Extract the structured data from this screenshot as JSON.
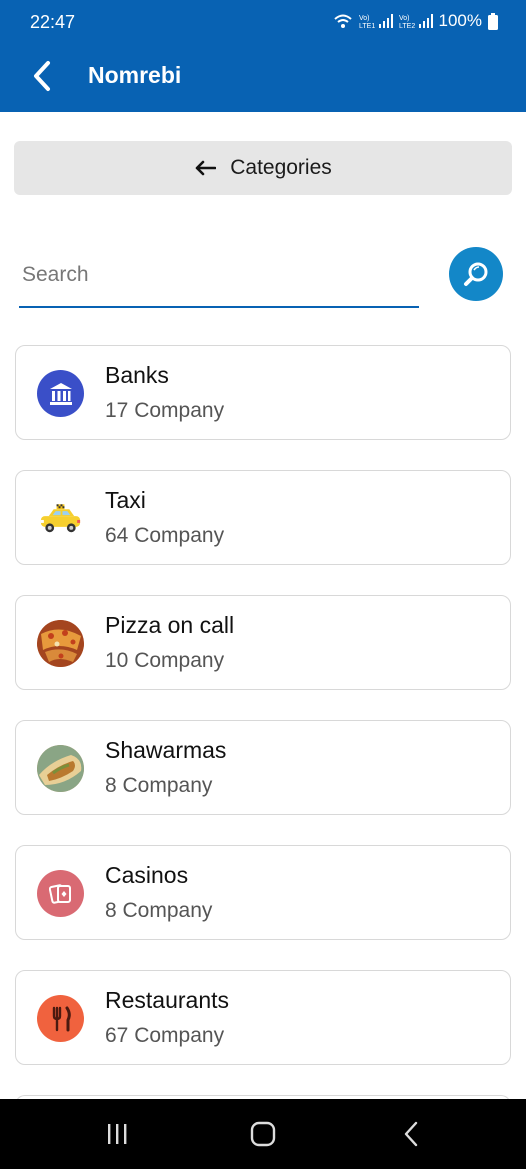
{
  "status_bar": {
    "time": "22:47",
    "battery": "100%",
    "sim1": "LTE1",
    "sim2": "LTE2"
  },
  "app_bar": {
    "title": "Nomrebi"
  },
  "categories_button": {
    "label": "Categories"
  },
  "search": {
    "placeholder": "Search",
    "value": ""
  },
  "categories": [
    {
      "name": "Banks",
      "count": "17 Company",
      "icon": "bank-icon",
      "color": "#3a4fc8"
    },
    {
      "name": "Taxi",
      "count": "64 Company",
      "icon": "taxi-icon",
      "color": "#ffffff"
    },
    {
      "name": "Pizza on call",
      "count": "10 Company",
      "icon": "pizza-icon",
      "color": "#b5542e"
    },
    {
      "name": "Shawarmas",
      "count": "8 Company",
      "icon": "shawarma-icon",
      "color": "#b59a6a"
    },
    {
      "name": "Casinos",
      "count": "8 Company",
      "icon": "cards-icon",
      "color": "#d96a73"
    },
    {
      "name": "Restaurants",
      "count": "67 Company",
      "icon": "cutlery-icon",
      "color": "#f0623e"
    }
  ]
}
